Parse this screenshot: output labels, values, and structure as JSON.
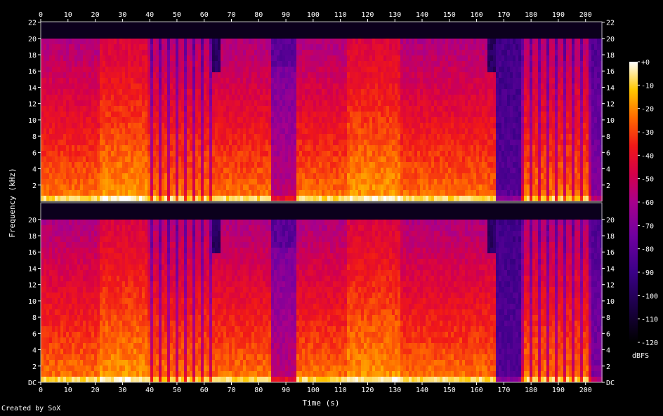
{
  "chart_data": {
    "type": "heatmap",
    "title": "",
    "xlabel": "Time (s)",
    "ylabel": "Frequency (kHz)",
    "colorbar_label": "dBFS",
    "x_range": [
      0,
      206
    ],
    "x_ticks": [
      0,
      10,
      20,
      30,
      40,
      50,
      60,
      70,
      80,
      90,
      100,
      110,
      120,
      130,
      140,
      150,
      160,
      170,
      180,
      190,
      200
    ],
    "y_range_khz": [
      0,
      22.05
    ],
    "y_ticks_top": [
      "22",
      "20",
      "18",
      "16",
      "14",
      "12",
      "10",
      "8",
      "6",
      "4",
      "2"
    ],
    "y_ticks_bottom": [
      "20",
      "18",
      "16",
      "14",
      "12",
      "10",
      "8",
      "6",
      "4",
      "2",
      "DC"
    ],
    "colorbar_ticks": [
      "+0",
      "-10",
      "-20",
      "-30",
      "-40",
      "-50",
      "-60",
      "-70",
      "-80",
      "-90",
      "-100",
      "-110",
      "-120"
    ],
    "colorbar_range_db": [
      -120,
      0
    ],
    "channels": 2,
    "lowpass_khz": 20,
    "segments": [
      {
        "t0": 0,
        "t1": 21,
        "character": "music"
      },
      {
        "t0": 21,
        "t1": 39,
        "character": "loud"
      },
      {
        "t0": 39,
        "t1": 62,
        "character": "music-gaps"
      },
      {
        "t0": 62,
        "t1": 65,
        "character": "cut-16k"
      },
      {
        "t0": 65,
        "t1": 84,
        "character": "music"
      },
      {
        "t0": 84,
        "t1": 93,
        "character": "quiet"
      },
      {
        "t0": 93,
        "t1": 112,
        "character": "music"
      },
      {
        "t0": 112,
        "t1": 131,
        "character": "loud"
      },
      {
        "t0": 131,
        "t1": 163,
        "character": "music"
      },
      {
        "t0": 163,
        "t1": 167,
        "character": "cut-16k"
      },
      {
        "t0": 167,
        "t1": 176,
        "character": "very-quiet"
      },
      {
        "t0": 176,
        "t1": 202,
        "character": "music-gaps"
      },
      {
        "t0": 202,
        "t1": 206,
        "character": "fade"
      }
    ],
    "colors": {
      "background": "#000000",
      "text": "#ffffff"
    }
  },
  "footer": {
    "credit": "Created by SoX"
  }
}
